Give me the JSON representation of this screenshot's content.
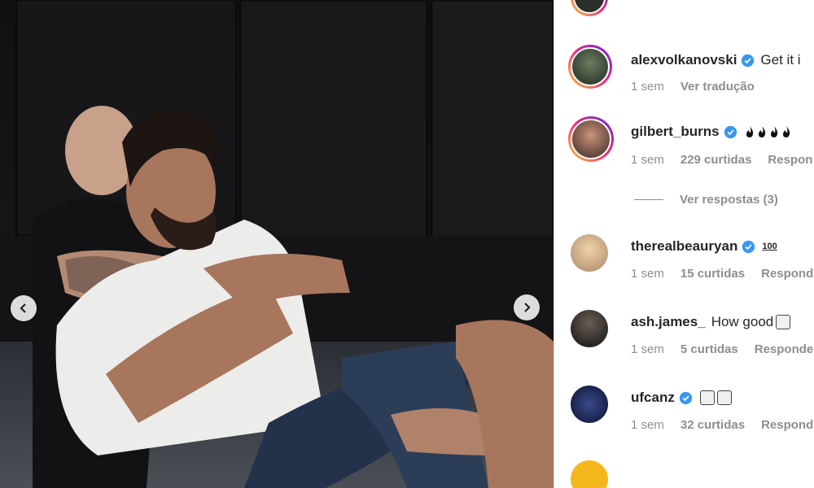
{
  "post": {
    "prev_icon": "chevron-left-icon",
    "next_icon": "chevron-right-icon"
  },
  "comments": [
    {
      "username": "alexvolkanovski",
      "verified": true,
      "text": "Get it i",
      "time": "1 sem",
      "action": "Ver tradução"
    },
    {
      "username": "gilbert_burns",
      "verified": true,
      "text": "",
      "emoji": "fire-x4",
      "time": "1 sem",
      "likes": "229 curtidas",
      "reply": "Respon",
      "view_replies": "Ver respostas (3)"
    },
    {
      "username": "therealbeauryan",
      "verified": true,
      "badge": "100",
      "time": "1 sem",
      "likes": "15 curtidas",
      "reply": "Respond"
    },
    {
      "username": "ash.james_",
      "verified": false,
      "text": "How good",
      "emoji": "face",
      "time": "1 sem",
      "likes": "5 curtidas",
      "reply": "Responde"
    },
    {
      "username": "ufcanz",
      "verified": true,
      "emoji": "faces-x2",
      "time": "1 sem",
      "likes": "32 curtidas",
      "reply": "Respond"
    }
  ],
  "colors": {
    "verified": "#3897f0",
    "meta": "#8e8e8e",
    "text": "#262626"
  }
}
